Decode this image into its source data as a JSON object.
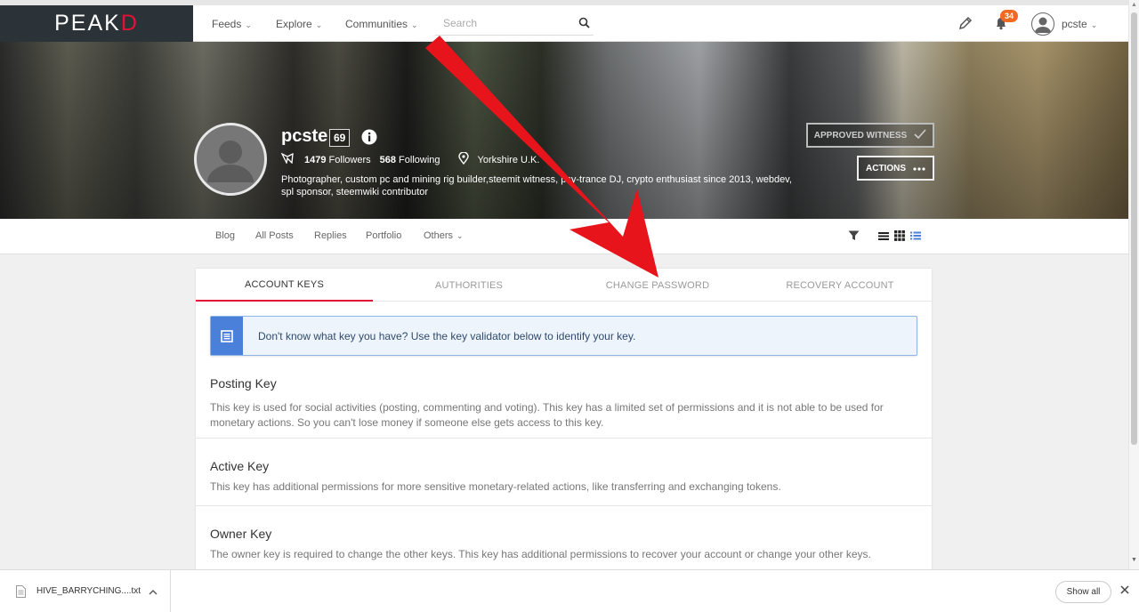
{
  "nav": {
    "logo_main": "PE",
    "logo_accent_a": "A",
    "logo_mid": "K",
    "logo_accent_d": "D",
    "feeds": "Feeds",
    "explore": "Explore",
    "communities": "Communities",
    "search_placeholder": "Search",
    "notifications_count": "34",
    "username": "pcste"
  },
  "profile": {
    "name": "pcste",
    "reputation": "69",
    "followers_count": "1479",
    "followers_label": "Followers",
    "following_count": "568",
    "following_label": "Following",
    "location": "Yorkshire U.K.",
    "bio": "Photographer, custom pc and mining rig builder,steemit witness, psy-trance DJ, crypto enthusiast since 2013, webdev, spl sponsor, steemwiki contributor",
    "witness_button": "APPROVED WITNESS",
    "actions_button": "ACTIONS"
  },
  "profile_tabs": {
    "blog": "Blog",
    "all_posts": "All Posts",
    "replies": "Replies",
    "portfolio": "Portfolio",
    "others": "Others"
  },
  "key_tabs": {
    "account_keys": "ACCOUNT KEYS",
    "authorities": "AUTHORITIES",
    "change_password": "CHANGE PASSWORD",
    "recovery_account": "RECOVERY ACCOUNT"
  },
  "notice": "Don't know what key you have? Use the key validator below to identify your key.",
  "sections": {
    "posting": {
      "title": "Posting Key",
      "desc": "This key is used for social activities (posting, commenting and voting). This key has a limited set of permissions and it is not able to be used for monetary actions. So you can't lose money if someone else gets access to this key."
    },
    "active": {
      "title": "Active Key",
      "desc": "This key has additional permissions for more sensitive monetary-related actions, like transferring and exchanging tokens."
    },
    "owner": {
      "title": "Owner Key",
      "desc": "The owner key is required to change the other keys. This key has additional permissions to recover your account or change your other keys."
    }
  },
  "download": {
    "filename": "HIVE_BARRYCHING....txt",
    "show_all": "Show all"
  },
  "colors": {
    "brand_red": "#e31337",
    "logo_bg": "#2b3339",
    "badge_orange": "#f26a21",
    "notice_blue": "#4a80d9",
    "arrow_red": "#e8141c"
  }
}
